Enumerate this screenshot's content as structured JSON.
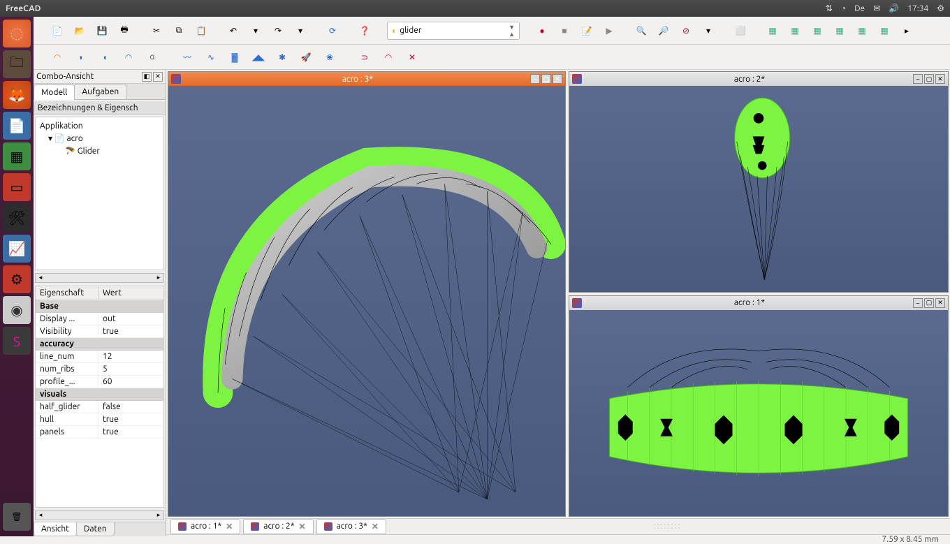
{
  "topbar": {
    "title": "FreeCAD",
    "lang": "De",
    "time": "17:34"
  },
  "launcher": {
    "items": [
      "dash",
      "files",
      "firefox",
      "writer",
      "calc",
      "impress",
      "settings",
      "matlab",
      "gear",
      "cd",
      "sublime"
    ]
  },
  "toolbar1": {
    "workbench": "glider"
  },
  "combo": {
    "panel_title": "Combo-Ansicht",
    "tabs": {
      "model": "Modell",
      "tasks": "Aufgaben"
    },
    "tree_header": "Bezeichnungen & Eigensch",
    "tree": {
      "app": "Applikation",
      "doc": "acro",
      "obj": "Glider"
    },
    "prop_headers": {
      "name": "Eigenschaft",
      "value": "Wert"
    },
    "groups": {
      "base": "Base",
      "accuracy": "accuracy",
      "visuals": "visuals"
    },
    "props": [
      {
        "k": "Display ...",
        "v": "out"
      },
      {
        "k": "Visibility",
        "v": "true"
      },
      {
        "k": "line_num",
        "v": "12"
      },
      {
        "k": "num_ribs",
        "v": "5"
      },
      {
        "k": "profile_...",
        "v": "60"
      },
      {
        "k": "half_glider",
        "v": "false"
      },
      {
        "k": "hull",
        "v": "true"
      },
      {
        "k": "panels",
        "v": "true"
      }
    ],
    "bottom_tabs": {
      "view": "Ansicht",
      "data": "Daten"
    }
  },
  "views": {
    "v3": "acro : 3*",
    "v2": "acro : 2*",
    "v1": "acro : 1*"
  },
  "doctabs": [
    "acro : 1*",
    "acro : 2*",
    "acro : 3*"
  ],
  "status": "7.59 x 8.45 mm"
}
